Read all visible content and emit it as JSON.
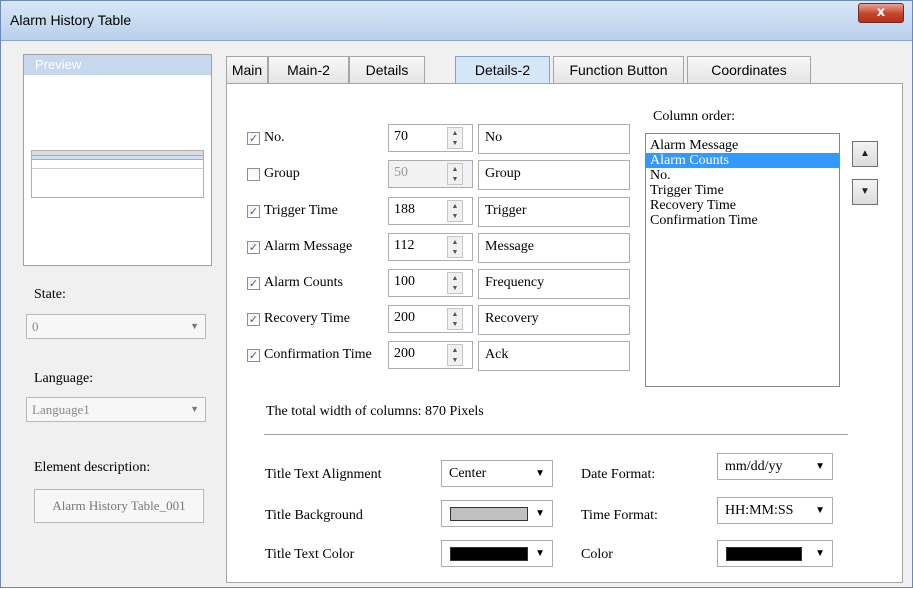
{
  "window": {
    "title": "Alarm History Table",
    "close_glyph": "x"
  },
  "left": {
    "preview_label": "Preview",
    "state_label": "State:",
    "state_value": "0",
    "language_label": "Language:",
    "language_value": "Language1",
    "element_desc_label": "Element description:",
    "element_desc_value": "Alarm History Table_001"
  },
  "tabs": [
    {
      "label": "Main"
    },
    {
      "label": "Main-2"
    },
    {
      "label": "Details"
    },
    {
      "label": "Details-2",
      "active": true
    },
    {
      "label": "Function Button"
    },
    {
      "label": "Coordinates"
    }
  ],
  "columns": [
    {
      "label": "No.",
      "checked": true,
      "width": "70",
      "title": "No"
    },
    {
      "label": "Group",
      "checked": false,
      "width": "50",
      "title": "Group"
    },
    {
      "label": "Trigger Time",
      "checked": true,
      "width": "188",
      "title": "Trigger"
    },
    {
      "label": "Alarm Message",
      "checked": true,
      "width": "112",
      "title": "Message"
    },
    {
      "label": "Alarm Counts",
      "checked": true,
      "width": "100",
      "title": "Frequency"
    },
    {
      "label": "Recovery Time",
      "checked": true,
      "width": "200",
      "title": "Recovery"
    },
    {
      "label": "Confirmation Time",
      "checked": true,
      "width": "200",
      "title": "Ack"
    }
  ],
  "column_order": {
    "label": "Column order:",
    "items": [
      "Alarm Message",
      "Alarm Counts",
      "No.",
      "Trigger Time",
      "Recovery Time",
      "Confirmation Time"
    ],
    "selected": "Alarm Counts"
  },
  "total_width_text": "The total width of columns: 870 Pixels",
  "settings": {
    "title_text_alignment_label": "Title Text Alignment",
    "title_text_alignment_value": "Center",
    "title_background_label": "Title Background",
    "title_background_color": "#c0c0c0",
    "title_text_color_label": "Title Text Color",
    "title_text_color": "#000000",
    "date_format_label": "Date Format:",
    "date_format_value": "mm/dd/yy",
    "time_format_label": "Time Format:",
    "time_format_value": "HH:MM:SS",
    "color_label": "Color",
    "color_value": "#000000"
  },
  "icons": {
    "checkbox_check": "check-icon",
    "spin_up": "triangle-up-icon",
    "spin_down": "triangle-down-icon",
    "dropdown": "triangle-down-icon",
    "move_up": "triangle-up-icon",
    "move_down": "triangle-down-icon"
  },
  "colors": {
    "selection": "#3399ff",
    "active_tab": "#d5e6f8",
    "title_bar": "#c9dcf2"
  }
}
